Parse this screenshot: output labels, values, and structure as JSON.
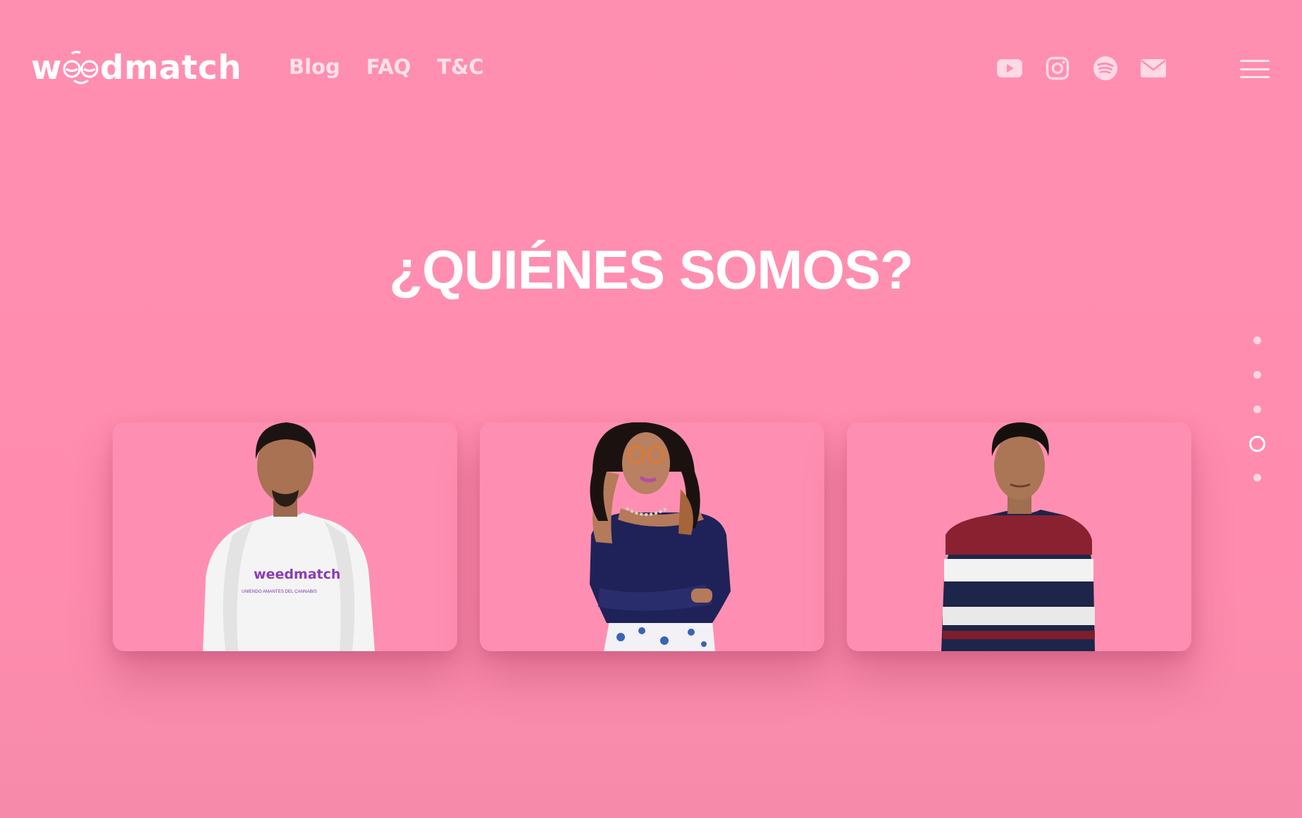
{
  "brand": {
    "logo_prefix": "w",
    "logo_suffix": "dmatch"
  },
  "nav": {
    "items": [
      "Blog",
      "FAQ",
      "T&C"
    ]
  },
  "social": {
    "icons": [
      "youtube-icon",
      "instagram-icon",
      "spotify-icon",
      "mail-icon"
    ]
  },
  "hero": {
    "title": "¿QUIÉNES SOMOS?"
  },
  "pagination": {
    "count": 5,
    "active_index": 3
  },
  "team": {
    "cards": [
      {
        "shirt_logo": "weedmatch",
        "shirt_tagline": "UNIENDO AMANTES DEL CANNABIS"
      },
      {},
      {}
    ]
  },
  "colors": {
    "background": "#ff8fb1",
    "text": "#ffffff",
    "nav_text": "#ffe1ea"
  }
}
